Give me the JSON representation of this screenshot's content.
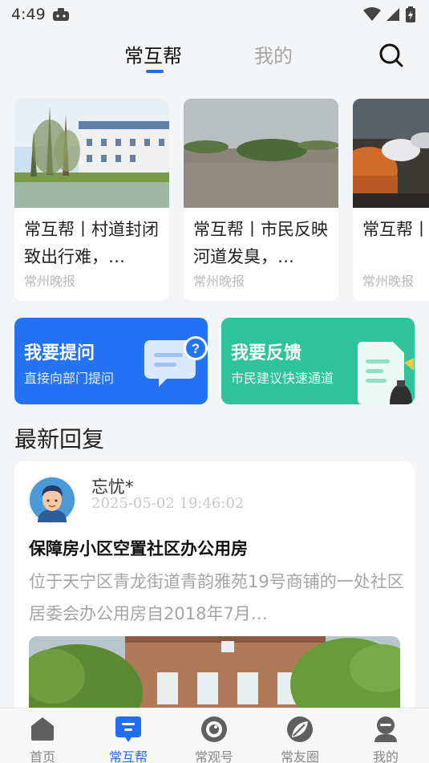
{
  "status_bar": {
    "time": "4:49"
  },
  "top_tabs": [
    {
      "label": "常互帮",
      "active": true
    },
    {
      "label": "我的",
      "active": false
    }
  ],
  "news_cards": [
    {
      "title": "常互帮丨村道封闭致出行难，…",
      "source": "常州晚报"
    },
    {
      "title": "常互帮丨市民反映河道发臭，…",
      "source": "常州晚报"
    },
    {
      "title": "常互帮丨堵路又…",
      "source": "常州晚报"
    }
  ],
  "actions": {
    "ask": {
      "title": "我要提问",
      "subtitle": "直接向部门提问",
      "color": "#2573f5"
    },
    "feedback": {
      "title": "我要反馈",
      "subtitle": "市民建议快速通道",
      "color": "#2fc39a"
    }
  },
  "latest": {
    "section_title": "最新回复",
    "user": "忘忧*",
    "time": "2025-05-02 19:46:02",
    "title": "保障房小区空置社区办公用房",
    "body": "位于天宁区青龙街道青韵雅苑19号商铺的一处社区居委会办公用房自2018年7月…"
  },
  "bottom_nav": [
    {
      "label": "首页",
      "icon": "home-icon",
      "active": false
    },
    {
      "label": "常互帮",
      "icon": "chat-icon",
      "active": true
    },
    {
      "label": "常观号",
      "icon": "eye-icon",
      "active": false
    },
    {
      "label": "常友圈",
      "icon": "leaf-icon",
      "active": false
    },
    {
      "label": "我的",
      "icon": "user-icon",
      "active": false
    }
  ],
  "colors": {
    "accent": "#1f6ef5"
  }
}
